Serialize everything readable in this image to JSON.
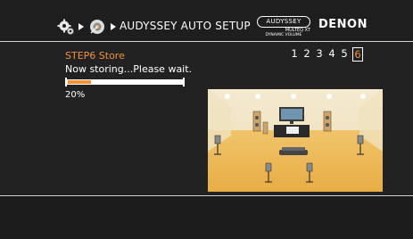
{
  "header": {
    "breadcrumb_title": "AUDYSSEY AUTO SETUP",
    "audyssey_logo_text": "AUDYSSEY",
    "audyssey_sub1": "MULTEQ XT",
    "audyssey_sub2": "DYNAMIC VOLUME",
    "brand": "DENON",
    "icons": [
      "setup-gears-icon",
      "chevron-right-icon",
      "speaker-setup-icon",
      "chevron-right-icon"
    ]
  },
  "main": {
    "step_title": "STEP6 Store",
    "status_text": "Now storing...Please wait.",
    "steps": [
      "1",
      "2",
      "3",
      "4",
      "5",
      "6"
    ],
    "active_step": "6",
    "progress_fraction": 0.2,
    "progress_label": "20%",
    "illustration": "room-speaker-layout"
  },
  "colors": {
    "accent": "#f0913b",
    "background": "#222222",
    "text": "#ffffff"
  }
}
